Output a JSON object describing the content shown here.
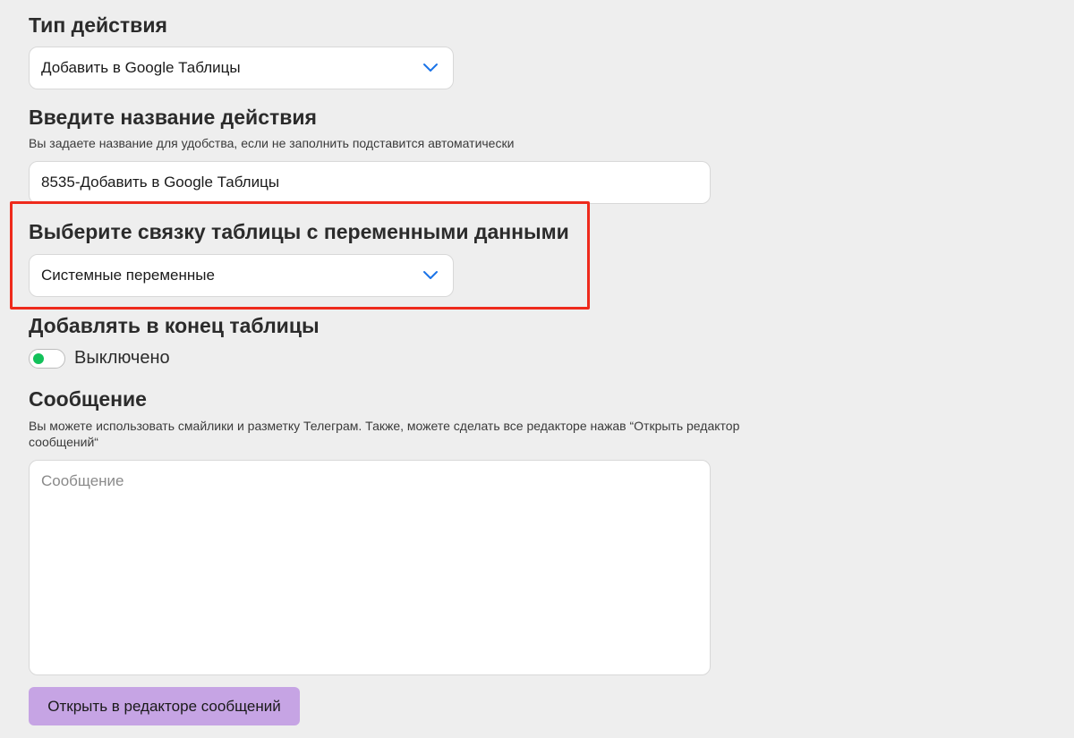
{
  "action_type": {
    "label": "Тип действия",
    "selected": "Добавить в Google Таблицы"
  },
  "action_name": {
    "label": "Введите название действия",
    "hint": "Вы задаете название для удобства, если не заполнить подставится автоматически",
    "value": "8535-Добавить в Google Таблицы"
  },
  "table_binding": {
    "label": "Выберите связку таблицы с переменными данными",
    "selected": "Системные переменные"
  },
  "append_to_end": {
    "label": "Добавлять в конец таблицы",
    "state_label": "Выключено"
  },
  "message": {
    "label": "Сообщение",
    "hint": "Вы можете использовать смайлики и разметку Телеграм. Также, можете сделать все редакторе нажав “Открыть редактор сообщений“",
    "placeholder": "Сообщение"
  },
  "open_editor_button": {
    "label": "Открыть в редакторе сообщений"
  },
  "icons": {
    "dropdown": "chevron-down-icon"
  },
  "colors": {
    "background": "#eeeeee",
    "chevron": "#1a73e8",
    "highlight": "#ee2a1c",
    "toggle_knob": "#12c15a",
    "button": "#c6a4e4"
  }
}
